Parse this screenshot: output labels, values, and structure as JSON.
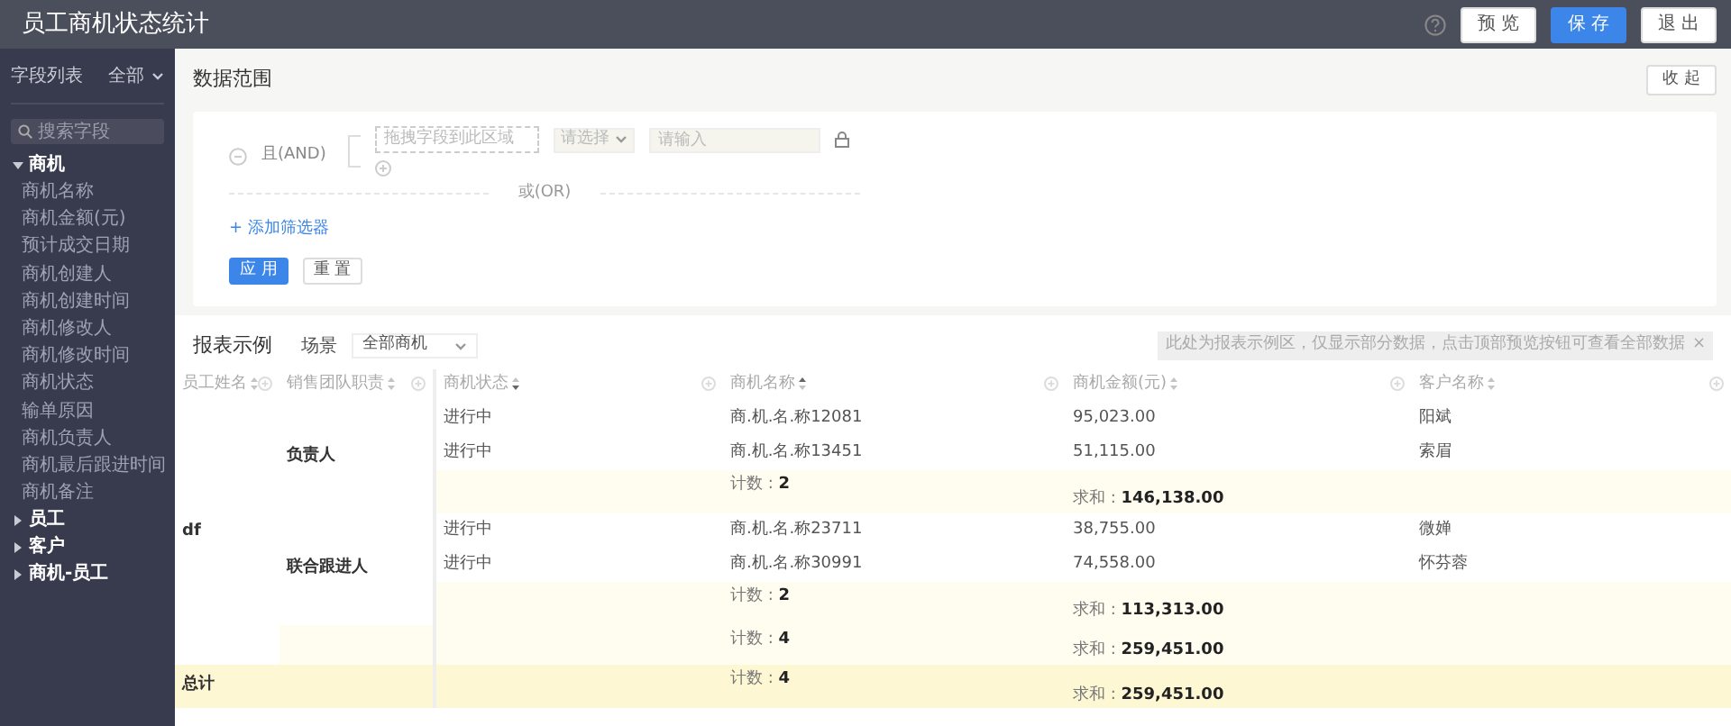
{
  "window": {
    "title": "员工商机状态统计"
  },
  "toolbar": {
    "buttons": [
      {
        "label": "预 览",
        "kind": "default"
      },
      {
        "label": "保 存",
        "kind": "primary"
      },
      {
        "label": "退 出",
        "kind": "default"
      }
    ]
  },
  "sidebar": {
    "title": "字段列表",
    "scope": "全部",
    "search": {
      "placeholder": "搜索字段"
    },
    "tree": [
      {
        "label": "商机",
        "expanded": true,
        "children": [
          {
            "label": "商机名称"
          },
          {
            "label": "商机金额(元)"
          },
          {
            "label": "预计成交日期"
          },
          {
            "label": "商机创建人"
          },
          {
            "label": "商机创建时间"
          },
          {
            "label": "商机修改人"
          },
          {
            "label": "商机修改时间"
          },
          {
            "label": "商机状态"
          },
          {
            "label": "输单原因"
          },
          {
            "label": "商机负责人"
          },
          {
            "label": "商机最后跟进时间"
          },
          {
            "label": "商机备注"
          }
        ]
      },
      {
        "label": "员工",
        "expanded": false
      },
      {
        "label": "客户",
        "expanded": false
      },
      {
        "label": "商机-员工",
        "expanded": false
      }
    ]
  },
  "data_range": {
    "title": "数据范围",
    "collapse_button": "收 起",
    "and_label": "且(AND)",
    "field_placeholder": "拖拽字段到此区域",
    "operator_placeholder": "请选择",
    "value_placeholder": "请输入",
    "or_label": "或(OR)",
    "add_filter": "+ 添加筛选器",
    "apply_button": "应 用",
    "reset_button": "重 置"
  },
  "report": {
    "title": "报表示例",
    "scene_label": "场景",
    "scene_value": "全部商机",
    "notice": "此处为报表示例区，仅显示部分数据，点击顶部预览按钮可查看全部数据",
    "notice_close": "×",
    "columns": [
      {
        "label": "员工姓名",
        "sorted_ascending": false,
        "sorted_descending": false
      },
      {
        "label": "销售团队职责",
        "sorted_ascending": false,
        "sorted_descending": false
      },
      {
        "label": "商机状态",
        "sorted_ascending": false,
        "sorted_descending": true
      },
      {
        "label": "商机名称",
        "sorted_ascending": true,
        "sorted_descending": false
      },
      {
        "label": "商机金额(元)",
        "sorted_ascending": false,
        "sorted_descending": false
      },
      {
        "label": "客户名称",
        "sorted_ascending": false,
        "sorted_descending": false
      }
    ],
    "groups": [
      {
        "employee": "df",
        "roles": [
          {
            "role": "负责人",
            "rows": [
              {
                "status": "进行中",
                "name": "商.机.名.称12081",
                "amount": "95,023.00",
                "customer": "阳斌"
              },
              {
                "status": "进行中",
                "name": "商.机.名.称13451",
                "amount": "51,115.00",
                "customer": "索眉"
              }
            ],
            "count": "计数 : **2**",
            "sum": "求和 : **146,138.00**"
          },
          {
            "role": "联合跟进人",
            "rows": [
              {
                "status": "进行中",
                "name": "商.机.名.称23711",
                "amount": "38,755.00",
                "customer": "微婵"
              },
              {
                "status": "进行中",
                "name": "商.机.名.称30991",
                "amount": "74,558.00",
                "customer": "怀芬蓉"
              }
            ],
            "count": "计数 : **2**",
            "sum": "求和 : **113,313.00**"
          }
        ],
        "count": "计数 : **4**",
        "sum": "求和 : **259,451.00**"
      }
    ],
    "total": {
      "label": "总计",
      "count": "计数 : **4**",
      "sum": "求和 : **259,451.00**"
    }
  }
}
